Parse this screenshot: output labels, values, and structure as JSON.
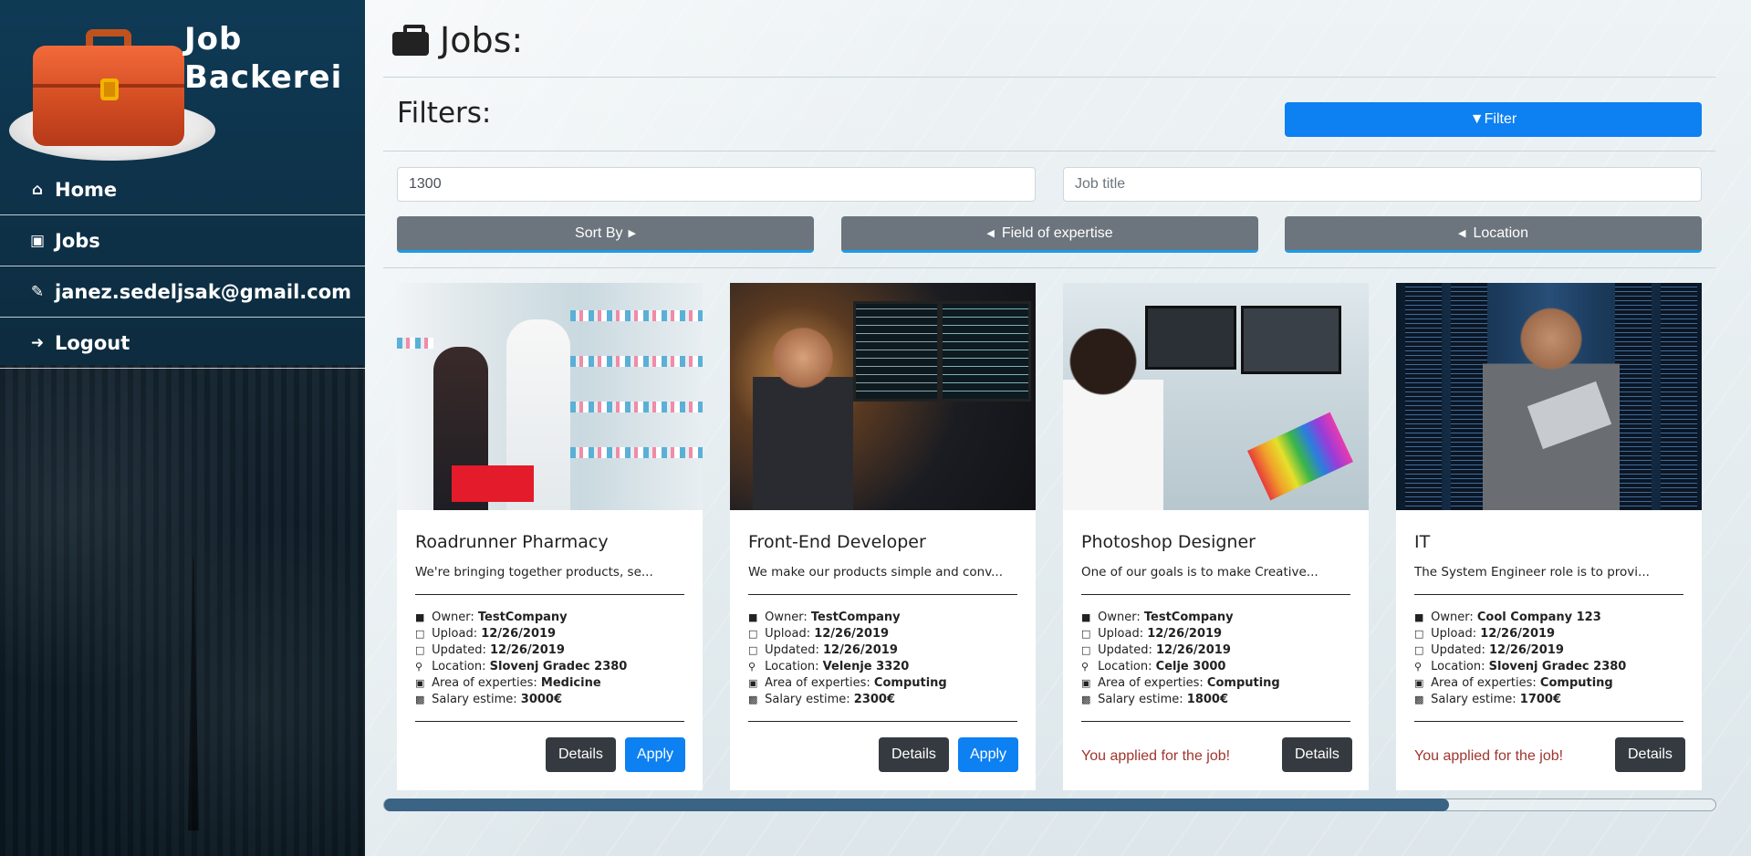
{
  "brand": {
    "title_line1": "Job",
    "title_line2": "Backerei"
  },
  "sidebar": {
    "items": [
      {
        "icon": "home-icon",
        "label": "Home"
      },
      {
        "icon": "briefcase-icon",
        "label": "Jobs"
      },
      {
        "icon": "pencil-icon",
        "label": "janez.sedeljsak@gmail.com"
      },
      {
        "icon": "logout-icon",
        "label": "Logout"
      }
    ]
  },
  "page": {
    "title": "Jobs:",
    "filters_label": "Filters:"
  },
  "filter": {
    "button_label": "Filter",
    "salary_value": "1300",
    "job_title_placeholder": "Job title",
    "sort_by_label": "Sort By",
    "field_label": "Field of expertise",
    "location_label": "Location"
  },
  "meta_labels": {
    "owner": "Owner:",
    "upload": "Upload:",
    "updated": "Updated:",
    "location": "Location:",
    "area": "Area of experties:",
    "salary": "Salary estime:"
  },
  "buttons": {
    "details": "Details",
    "apply": "Apply"
  },
  "applied_text": "You applied for the job!",
  "jobs": [
    {
      "title": "Roadrunner Pharmacy",
      "description": "We're bringing together products, se...",
      "owner": "TestCompany",
      "upload": "12/26/2019",
      "updated": "12/26/2019",
      "location": "Slovenj Gradec 2380",
      "area": "Medicine",
      "salary": "3000€",
      "applied": false
    },
    {
      "title": "Front-End Developer",
      "description": "We make our products simple and conv...",
      "owner": "TestCompany",
      "upload": "12/26/2019",
      "updated": "12/26/2019",
      "location": "Velenje 3320",
      "area": "Computing",
      "salary": "2300€",
      "applied": false
    },
    {
      "title": "Photoshop Designer",
      "description": "One of our goals is to make Creative...",
      "owner": "TestCompany",
      "upload": "12/26/2019",
      "updated": "12/26/2019",
      "location": "Celje 3000",
      "area": "Computing",
      "salary": "1800€",
      "applied": true
    },
    {
      "title": "IT",
      "description": "The System Engineer role is to provi...",
      "owner": "Cool Company 123",
      "upload": "12/26/2019",
      "updated": "12/26/2019",
      "location": "Slovenj Gradec 2380",
      "area": "Computing",
      "salary": "1700€",
      "applied": true
    }
  ],
  "scroll": {
    "position_fraction": 0.8
  },
  "colors": {
    "primary": "#0d80f2",
    "secondary": "#6c757d",
    "dark": "#343a40",
    "applied_text": "#a0352e",
    "sidebar": "#0f3a55"
  }
}
